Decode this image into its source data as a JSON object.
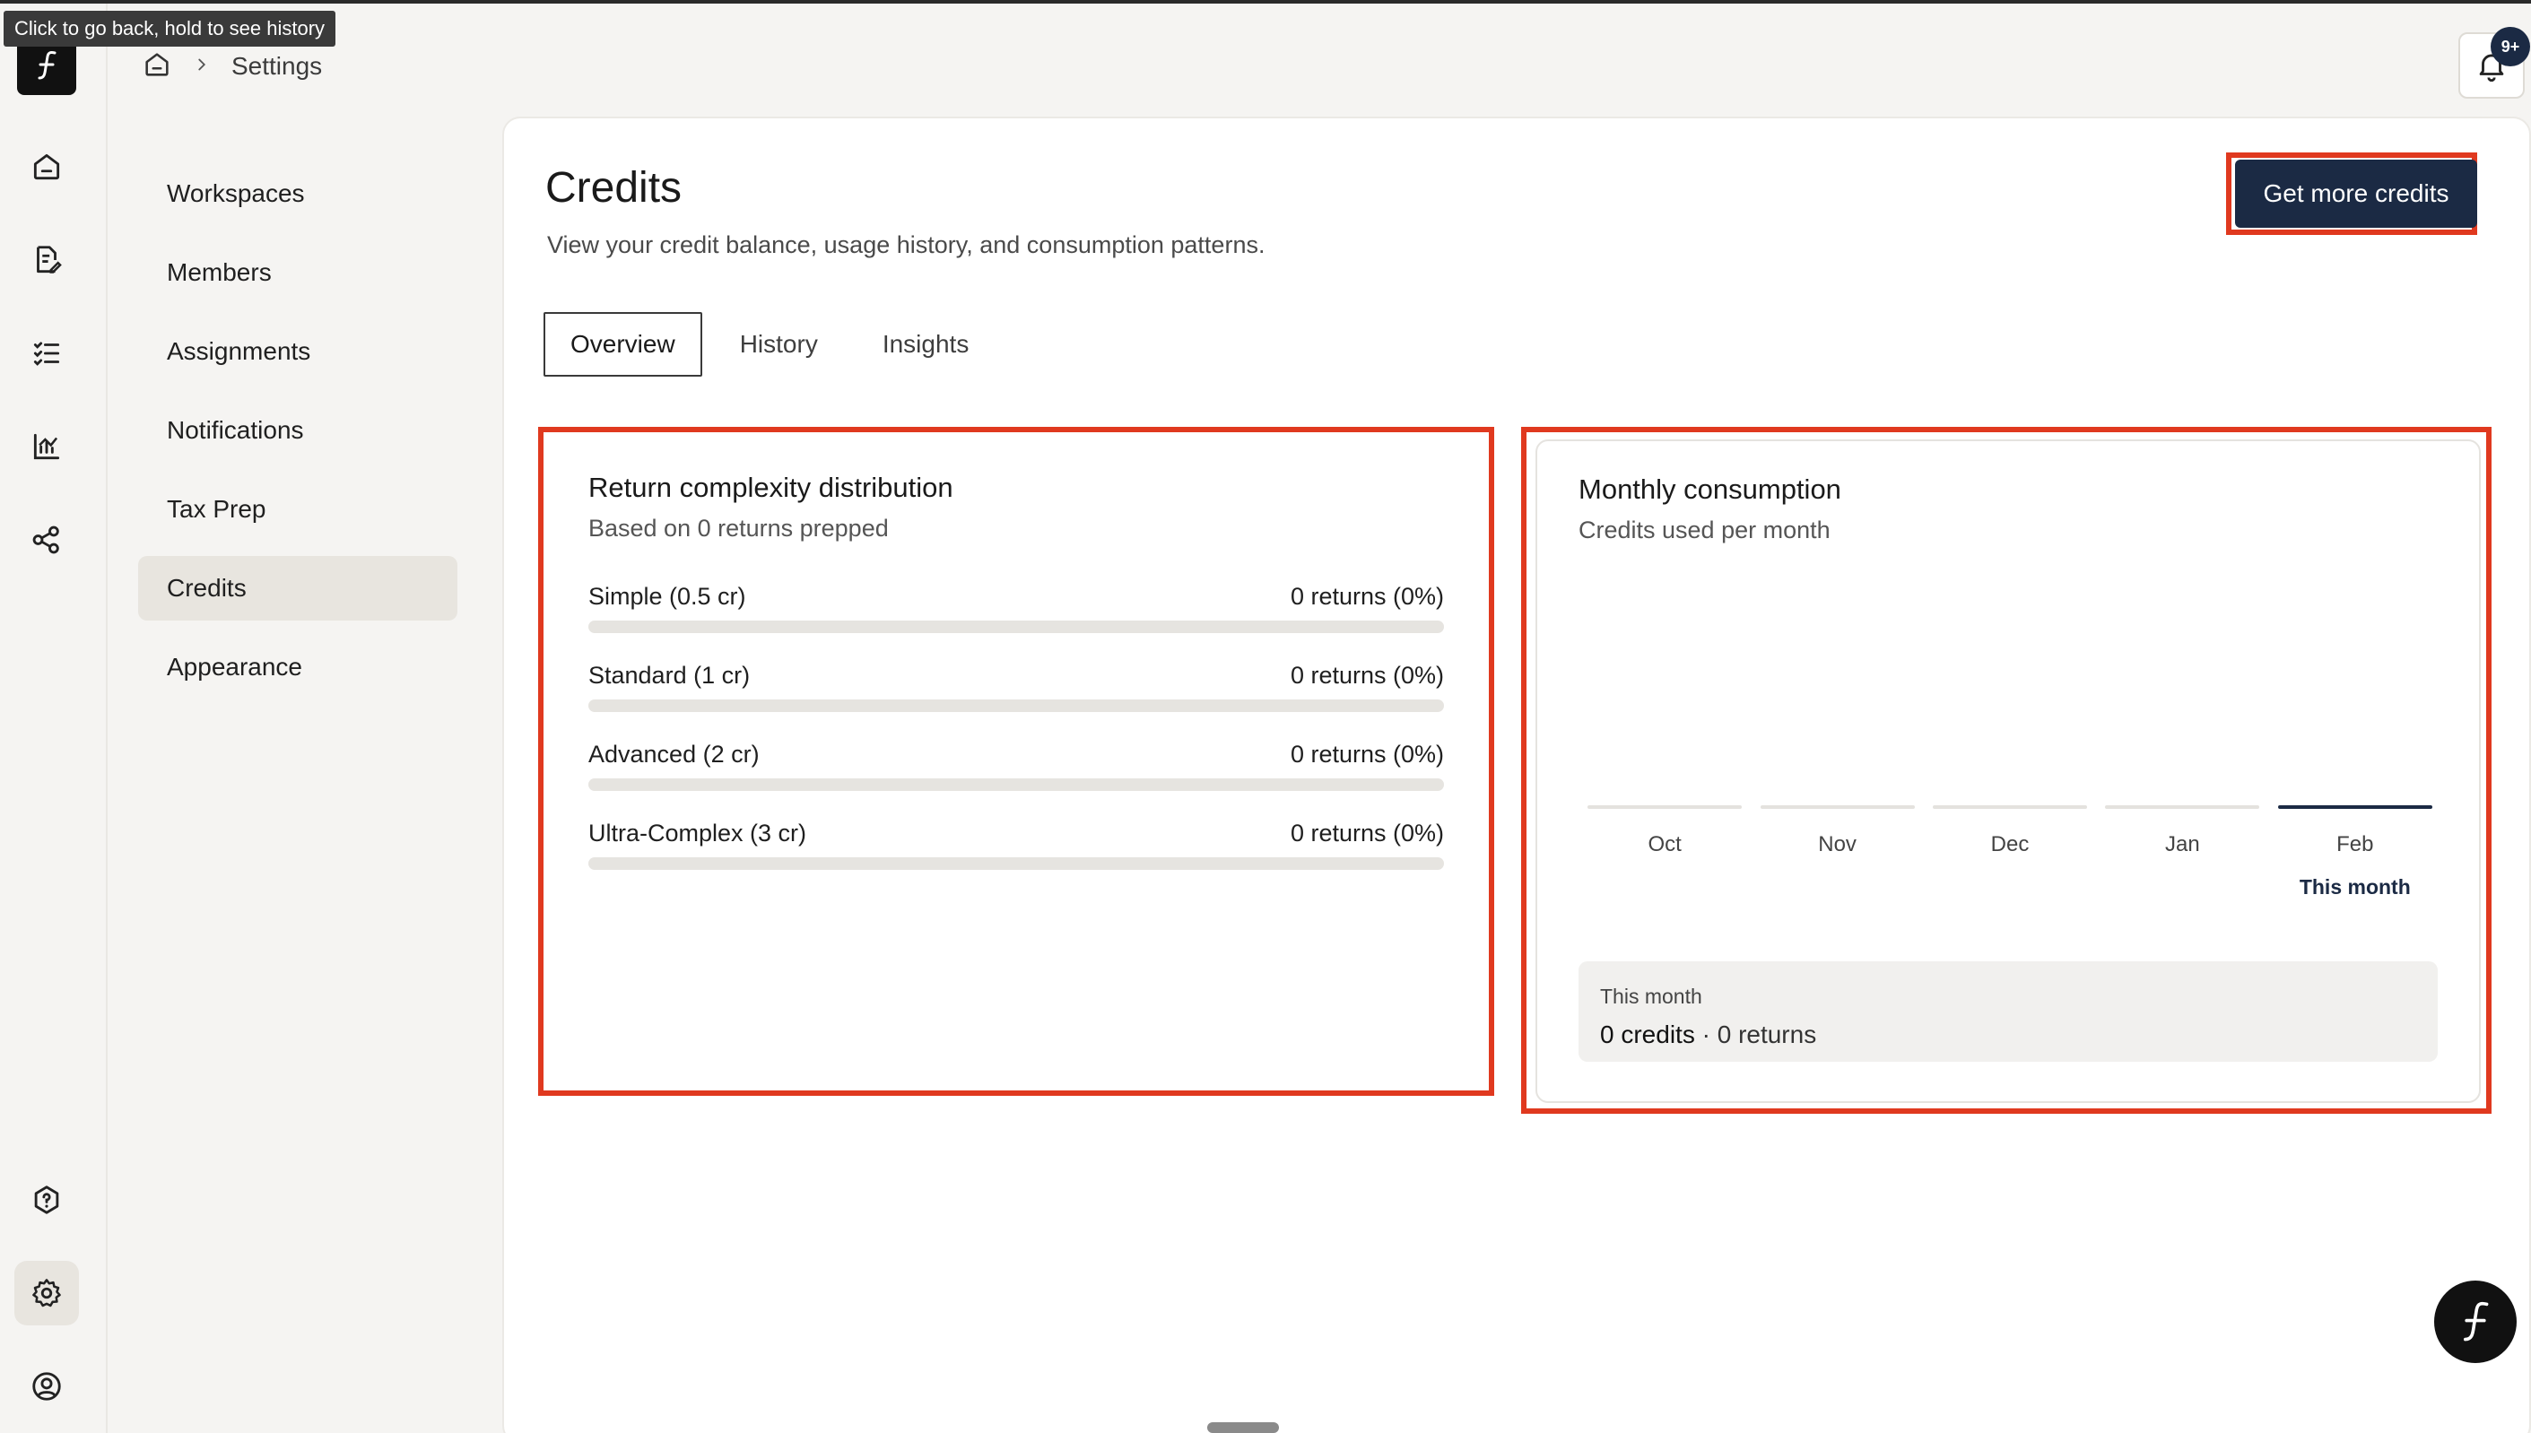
{
  "tooltip": "Click to go back, hold to see history",
  "breadcrumb": {
    "current": "Settings"
  },
  "notifications": {
    "badge": "9+"
  },
  "settings_nav": {
    "items": [
      {
        "label": "Workspaces",
        "active": false
      },
      {
        "label": "Members",
        "active": false
      },
      {
        "label": "Assignments",
        "active": false
      },
      {
        "label": "Notifications",
        "active": false
      },
      {
        "label": "Tax Prep",
        "active": false
      },
      {
        "label": "Credits",
        "active": true
      },
      {
        "label": "Appearance",
        "active": false
      }
    ]
  },
  "page": {
    "title": "Credits",
    "subtitle": "View your credit balance, usage history, and consumption patterns.",
    "cta_label": "Get more credits"
  },
  "tabs": [
    {
      "label": "Overview",
      "active": true
    },
    {
      "label": "History",
      "active": false
    },
    {
      "label": "Insights",
      "active": false
    }
  ],
  "distribution": {
    "title": "Return complexity distribution",
    "subtitle": "Based on 0 returns prepped",
    "rows": [
      {
        "label": "Simple (0.5 cr)",
        "value": "0 returns (0%)",
        "percent": 0
      },
      {
        "label": "Standard (1 cr)",
        "value": "0 returns (0%)",
        "percent": 0
      },
      {
        "label": "Advanced (2 cr)",
        "value": "0 returns (0%)",
        "percent": 0
      },
      {
        "label": "Ultra-Complex (3 cr)",
        "value": "0 returns (0%)",
        "percent": 0
      }
    ]
  },
  "consumption": {
    "title": "Monthly consumption",
    "subtitle": "Credits used per month",
    "this_month_tag": "This month",
    "summary_label": "This month",
    "summary_credits": "0 credits",
    "summary_returns": " · 0 returns"
  },
  "chart_data": {
    "type": "bar",
    "categories": [
      "Oct",
      "Nov",
      "Dec",
      "Jan",
      "Feb"
    ],
    "values": [
      0,
      0,
      0,
      0,
      0
    ],
    "highlight": "Feb",
    "title": "Monthly consumption",
    "xlabel": "",
    "ylabel": ""
  },
  "colors": {
    "accent": "#1b2a44",
    "highlight_outline": "#e0391f",
    "track": "#e6e4e0"
  },
  "icons": {
    "rail": [
      "home-icon",
      "document-edit-icon",
      "checklist-icon",
      "chart-icon",
      "share-icon",
      "help-icon",
      "gear-icon",
      "user-circle-icon"
    ]
  }
}
